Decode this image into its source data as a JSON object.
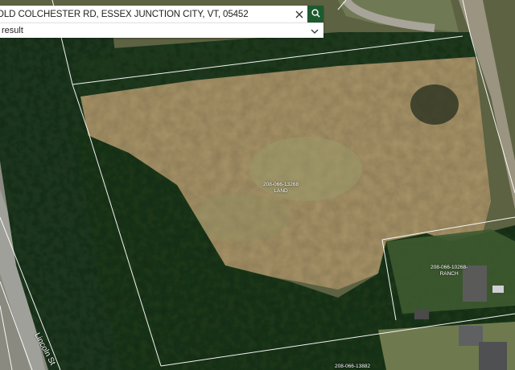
{
  "search": {
    "value": "OLD COLCHESTER RD, ESSEX JUNCTION CITY, VT, 05452",
    "clear_icon": "close-icon",
    "search_icon": "search-icon"
  },
  "results": {
    "label": "result",
    "toggle_icon": "chevron-down-icon"
  },
  "parcels": [
    {
      "id": "208-066-13268",
      "type": "LAND"
    },
    {
      "id": "208-066-10268-",
      "type": "RANCH"
    },
    {
      "id": "208-066-13882",
      "type": ""
    }
  ],
  "roads": {
    "lincoln": "Lincoln St"
  },
  "colors": {
    "search_button": "#1d5a2e",
    "parcel_line": "#ffffff",
    "field": "#a89468"
  }
}
